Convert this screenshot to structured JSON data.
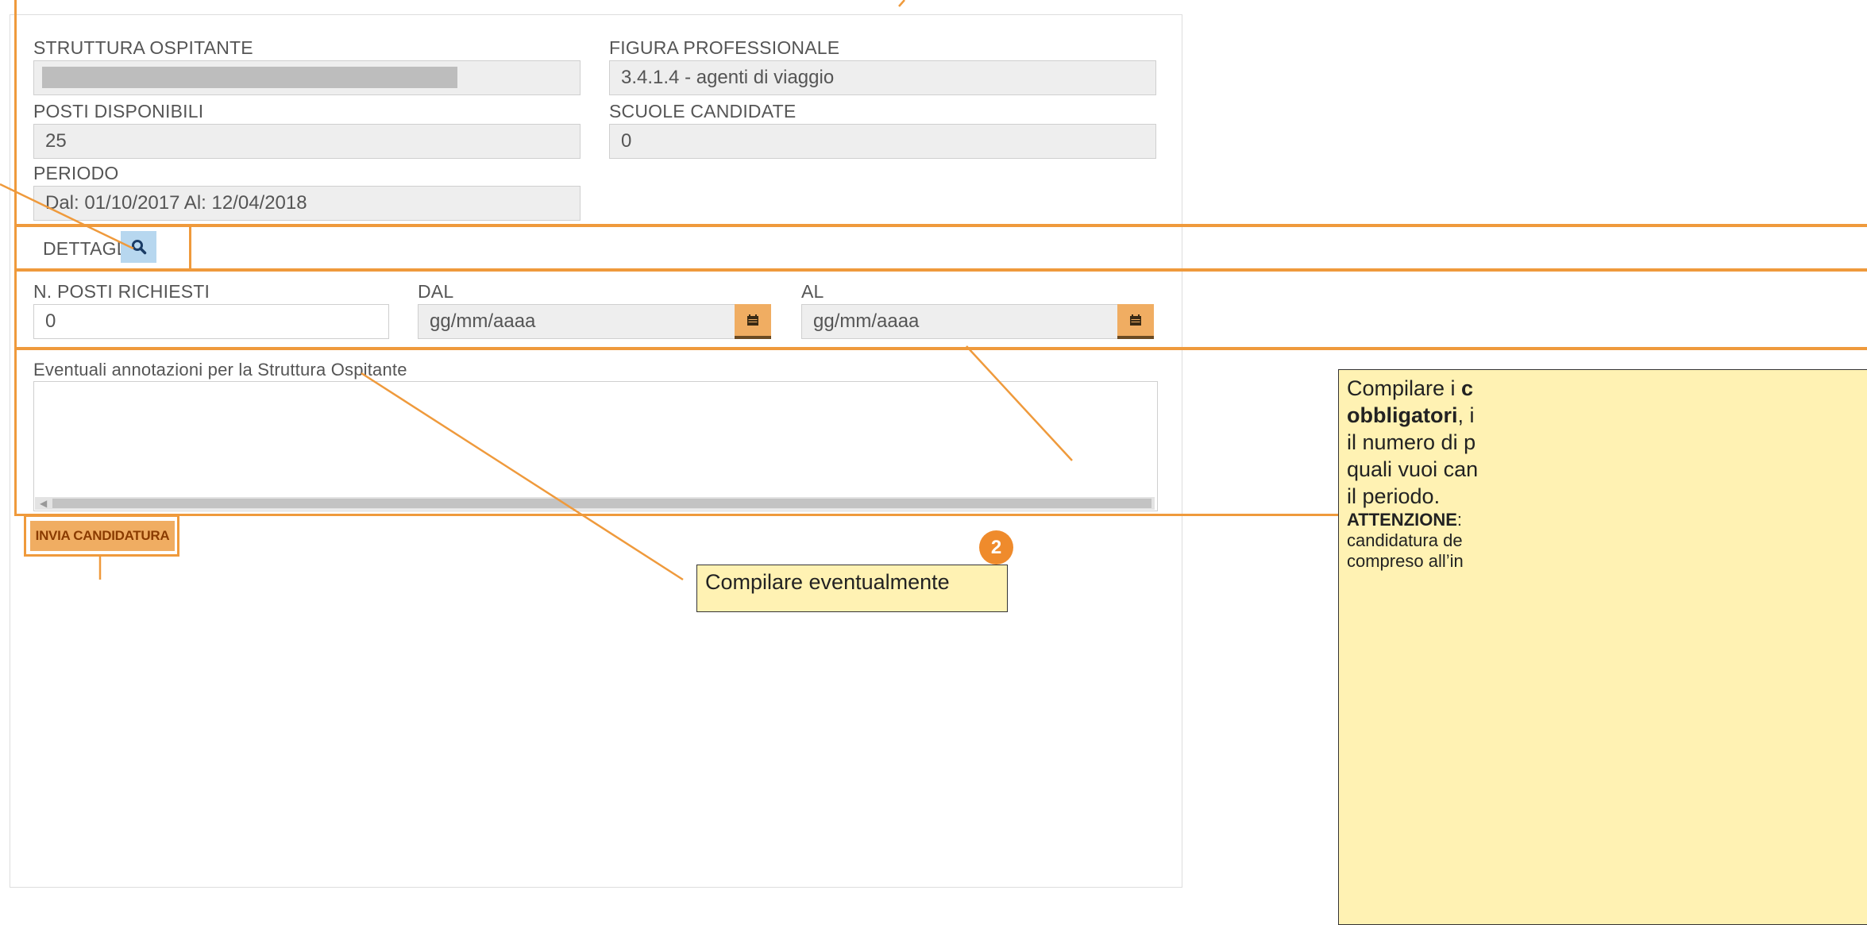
{
  "form": {
    "struttura_label": "STRUTTURA OSPITANTE",
    "figura_label": "FIGURA PROFESSIONALE",
    "figura_value": "3.4.1.4 - agenti di viaggio",
    "posti_label": "POSTI DISPONIBILI",
    "posti_value": "25",
    "scuole_label": "SCUOLE CANDIDATE",
    "scuole_value": "0",
    "periodo_label": "PERIODO",
    "periodo_value": "Dal: 01/10/2017 Al: 12/04/2018",
    "dettaglio_label": "DETTAGLIO",
    "n_posti_label": "N. POSTI RICHIESTI",
    "n_posti_value": "0",
    "dal_label": "DAL",
    "dal_placeholder": "gg/mm/aaaa",
    "al_label": "AL",
    "al_placeholder": "gg/mm/aaaa",
    "annotazioni_label": "Eventuali annotazioni per la Struttura Ospitante",
    "submit_label": "INVIA CANDIDATURA"
  },
  "icons": {
    "search": "search-icon",
    "calendar": "calendar-icon"
  },
  "callouts": {
    "right": {
      "text1": "Compilare i ",
      "bold1": "c",
      "bold2": "obbligatori",
      "text2": ", i",
      "line3": "il numero di p",
      "line4": "quali vuoi can",
      "line5": "il periodo.",
      "bold3": "ATTENZIONE",
      "text3": ":",
      "line7": "candidatura de",
      "line8": "compreso all’in"
    },
    "bottom": {
      "text": "Compilare eventualmente",
      "badge": "2"
    }
  },
  "colors": {
    "accent_orange": "#ef9a3c",
    "button_orange": "#f0ad62",
    "callout_bg": "#fff2b3",
    "detail_btn_bg": "#b7d7ef"
  }
}
